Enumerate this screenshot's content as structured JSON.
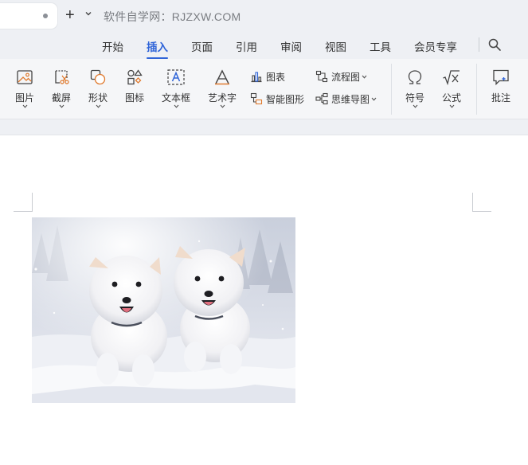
{
  "tabbar": {
    "new_tab_symbol": "+",
    "watermark_text": "软件自学网：RJZXW.COM"
  },
  "menu": {
    "items": [
      {
        "label": "开始"
      },
      {
        "label": "插入"
      },
      {
        "label": "页面"
      },
      {
        "label": "引用"
      },
      {
        "label": "审阅"
      },
      {
        "label": "视图"
      },
      {
        "label": "工具"
      },
      {
        "label": "会员专享"
      }
    ],
    "active_index": 1,
    "search_icon": "search-icon"
  },
  "ribbon": {
    "picture": "图片",
    "screenshot": "截屏",
    "shape": "形状",
    "icon": "图标",
    "textbox": "文本框",
    "wordart": "艺术字",
    "chart": "图表",
    "smartart": "智能图形",
    "flowchart": "流程图",
    "mindmap": "思维导图",
    "symbol": "符号",
    "formula": "公式",
    "comment": "批注"
  },
  "colors": {
    "accent": "#2f64d8",
    "toolbar_bg": "#eef0f4",
    "ribbon_bg": "#f5f6f8"
  },
  "document": {
    "image_subject": "two white puppies running in snow"
  }
}
